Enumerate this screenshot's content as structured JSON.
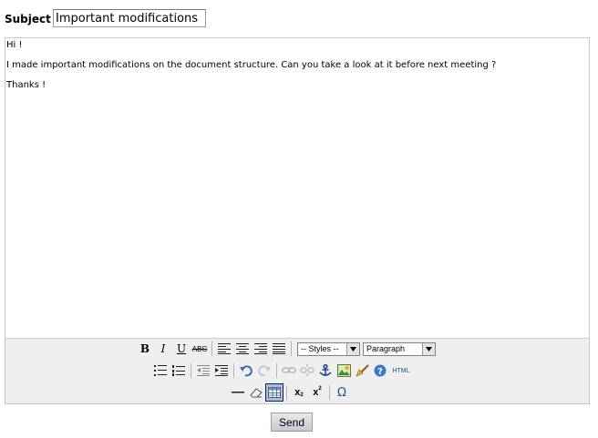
{
  "subject": {
    "label": "Subject",
    "value": "Important modifications"
  },
  "editor": {
    "lines": [
      "Hi !",
      "I made important modifications on the document structure. Can you take a look at it before next meeting ?",
      "Thanks !"
    ]
  },
  "toolbar": {
    "bold": "B",
    "italic": "I",
    "underline": "U",
    "strike": "ABC",
    "styles_select": "-- Styles --",
    "format_select": "Paragraph",
    "html_label": "HTML",
    "subscript": "x",
    "superscript": "x",
    "charmap": "Ω"
  },
  "send_button": "Send"
}
